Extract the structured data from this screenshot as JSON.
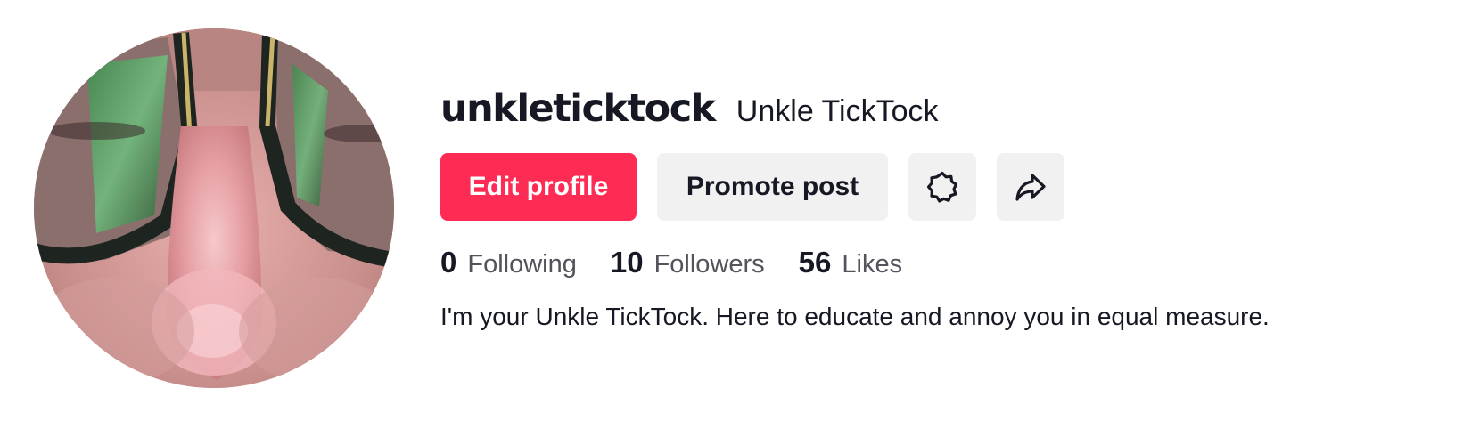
{
  "profile": {
    "username": "unkleticktock",
    "nickname": "Unkle TickTock",
    "bio": "I'm your Unkle TickTock. Here to educate and annoy you in equal measure."
  },
  "buttons": {
    "edit_profile": "Edit profile",
    "promote_post": "Promote post",
    "settings_icon": "gear-icon",
    "share_icon": "share-icon"
  },
  "stats": [
    {
      "value": "0",
      "label": "Following"
    },
    {
      "value": "10",
      "label": "Followers"
    },
    {
      "value": "56",
      "label": "Likes"
    }
  ],
  "colors": {
    "accent": "#fe2c55",
    "text_primary": "#161823",
    "text_secondary": "#52535b",
    "button_secondary_bg": "#f1f1f2"
  }
}
